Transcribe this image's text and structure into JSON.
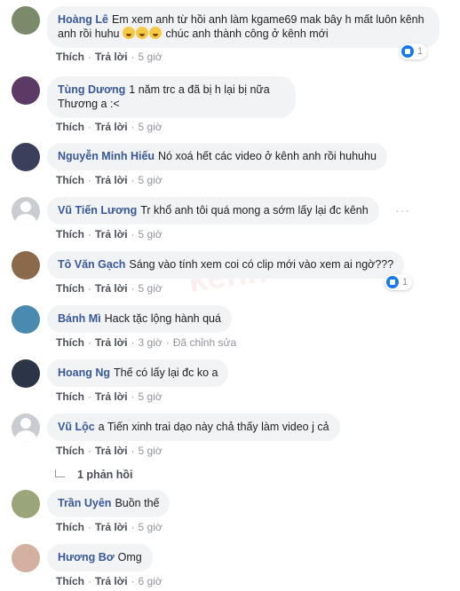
{
  "actions": {
    "like": "Thích",
    "reply": "Trả lời",
    "edited": "Đã chỉnh sửa"
  },
  "comments": [
    {
      "author": "Hoàng Lê",
      "text": "Em xem anh từ hồi anh làm kgame69 mak bây h mất luôn kênh anh rồi huhu",
      "text2": "chúc anh thành công ở kênh mới",
      "time": "5 giờ",
      "reactions": "1",
      "avatar_color": "#7a8a6a"
    },
    {
      "author": "Tùng Dương",
      "text": "1 năm trc a đã bị h lại bị nữa",
      "text2": "Thương a :<",
      "time": "5 giờ",
      "avatar_color": "#5b3a66"
    },
    {
      "author": "Nguyễn Minh Hiếu",
      "text": "Nó xoá hết các video ở kênh anh rồi huhuhu",
      "time": "5 giờ",
      "avatar_color": "#3a3f5c"
    },
    {
      "author": "Vũ Tiến Lương",
      "text": "Tr khổ anh tôi quá mong a sớm lấy lại đc kênh",
      "time": "5 giờ",
      "avatar_color": "#c9ccd1"
    },
    {
      "author": "Tô Văn Gạch",
      "text": "Sáng vào tính xem coi có clip mới vào xem ai ngờ???",
      "time": "5 giờ",
      "reactions": "1",
      "avatar_color": "#8a6a4a"
    },
    {
      "author": "Bánh Mì",
      "text": "Hack tặc lộng hành quá",
      "time": "3 giờ",
      "avatar_color": "#4a8ab0"
    },
    {
      "author": "Hoang Ng",
      "text": "Thế có lấy lại đc ko a",
      "time": "5 giờ",
      "avatar_color": "#2c3448"
    },
    {
      "author": "Vũ Lộc",
      "text": "a Tiến xinh trai dạo này chả thấy làm video j cả",
      "time": "5 giờ",
      "replies": "1 phản hồi",
      "avatar_color": "#c9ccd1"
    },
    {
      "author": "Trần Uyên",
      "text": "Buồn thế",
      "time": "5 giờ",
      "avatar_color": "#9aa67a"
    },
    {
      "author": "Hương Bơ",
      "text": "Omg",
      "time": "6 giờ",
      "avatar_color": "#d4b0a0"
    }
  ]
}
